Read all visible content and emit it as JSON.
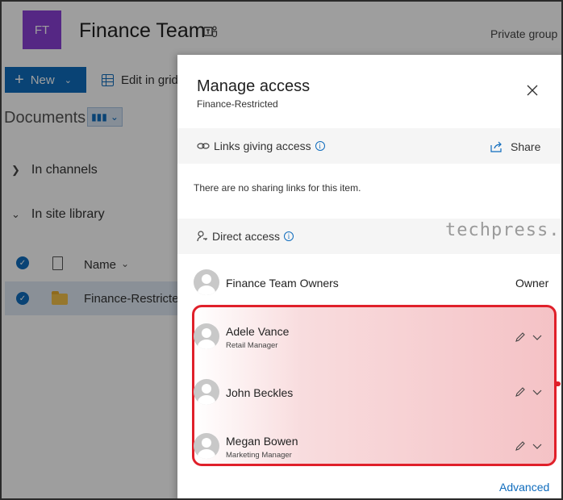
{
  "site": {
    "tile_initials": "FT",
    "title": "Finance Team",
    "visibility": "Private group",
    "brand_color": "#8a3fd6",
    "accent_color": "#0f6cbd"
  },
  "toolbar": {
    "new_label": "New",
    "edit_grid_label": "Edit in grid"
  },
  "library": {
    "title": "Documents",
    "tree": [
      {
        "label": "In channels"
      },
      {
        "label": "In site library"
      }
    ],
    "column_name": "Name",
    "selected_item": "Finance-Restricted"
  },
  "panel": {
    "title": "Manage access",
    "subtitle": "Finance-Restricted",
    "links_section": "Links giving access",
    "share_label": "Share",
    "no_links_text": "There are no sharing links for this item.",
    "direct_section": "Direct access",
    "watermark": "techpress.net",
    "owner_group": {
      "name": "Finance Team Owners",
      "role": "Owner"
    },
    "people": [
      {
        "name": "Adele Vance",
        "title": "Retail Manager"
      },
      {
        "name": "John Beckles",
        "title": ""
      },
      {
        "name": "Megan Bowen",
        "title": "Marketing Manager"
      }
    ],
    "advanced_label": "Advanced",
    "highlight_color": "#e0202a"
  }
}
